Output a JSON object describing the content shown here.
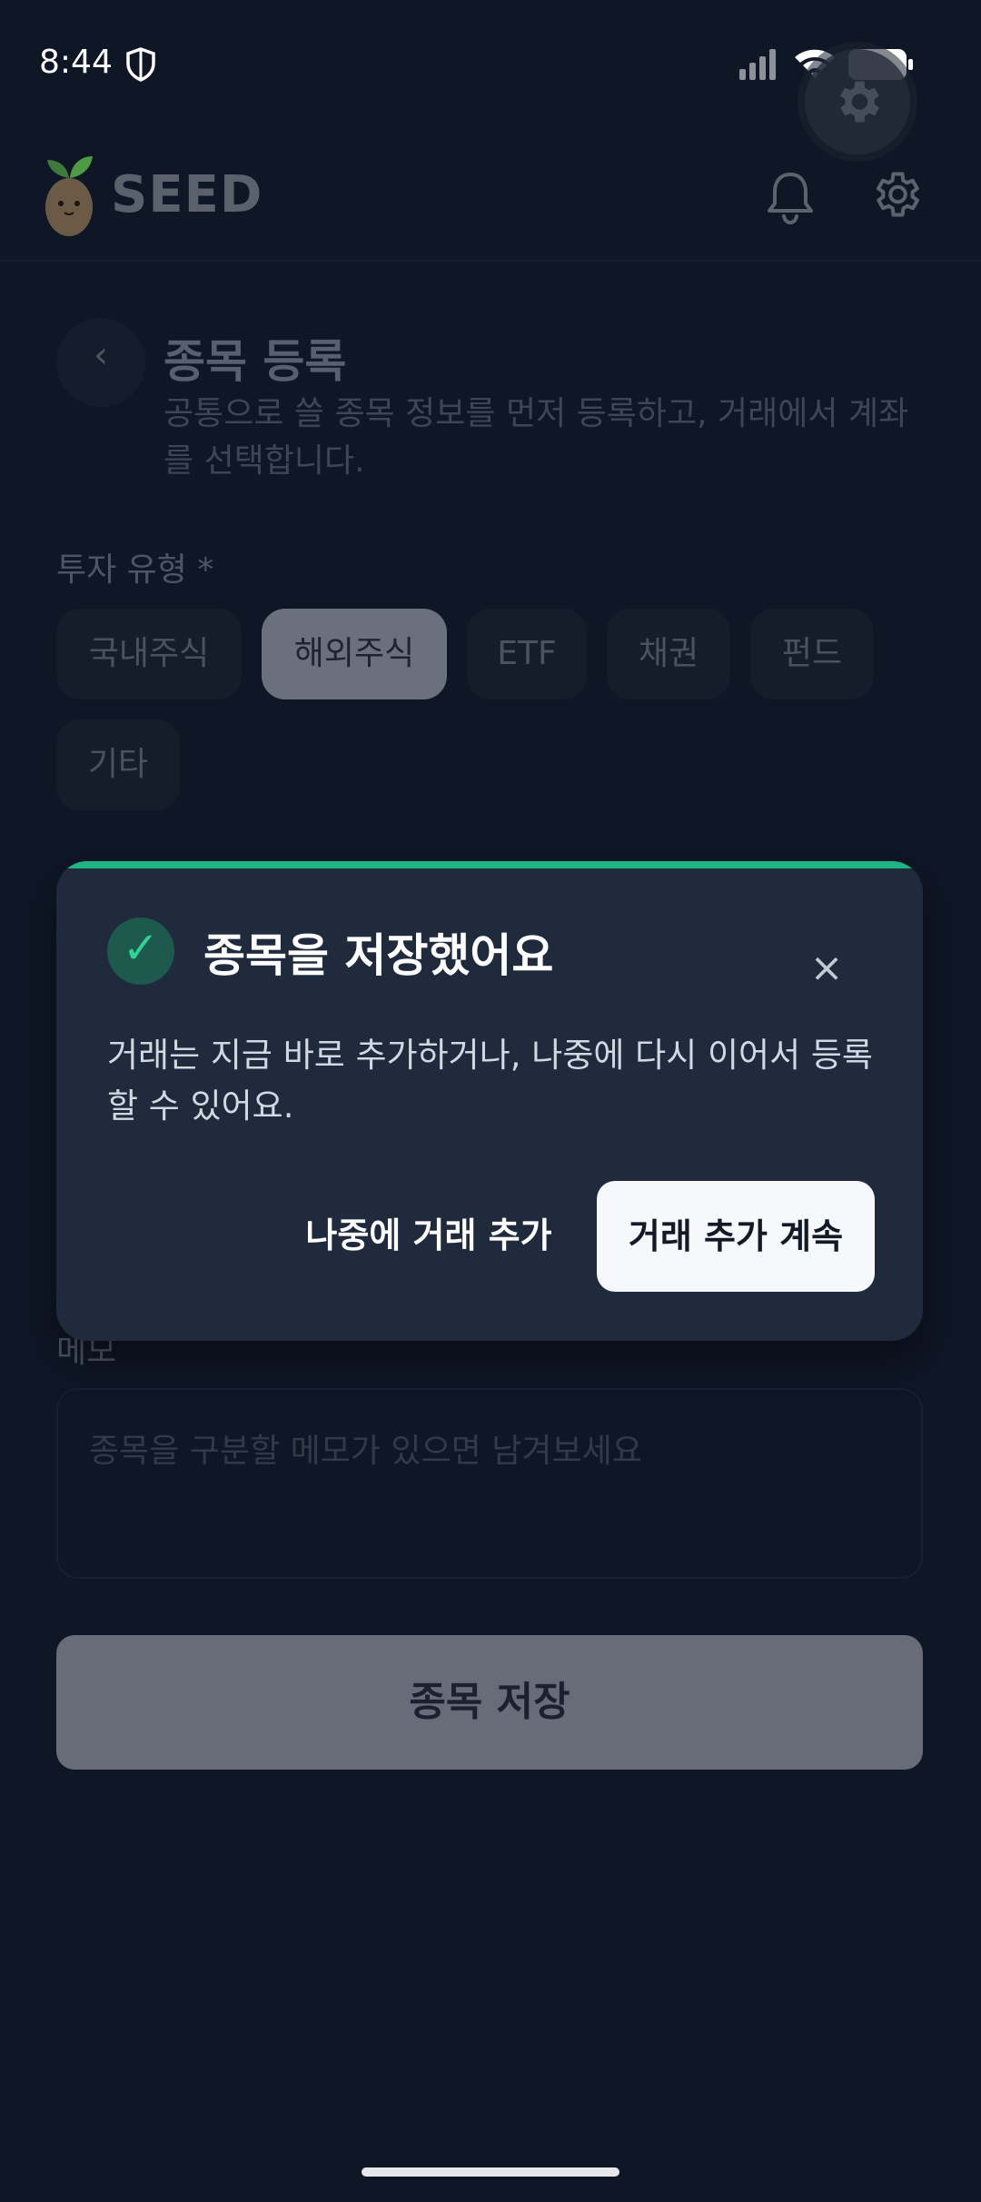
{
  "status_bar": {
    "time": "8:44"
  },
  "header": {
    "app_name": "SEED"
  },
  "page": {
    "back_glyph": "‹",
    "title": "종목 등록",
    "subtitle": "공통으로 쓸 종목 정보를 먼저 등록하고, 거래에서 계좌를 선택합니다."
  },
  "invest_type": {
    "label": "투자 유형 *",
    "options": [
      "국내주식",
      "해외주식",
      "ETF",
      "채권",
      "펀드",
      "기타"
    ],
    "selected": "해외주식"
  },
  "memo": {
    "label": "메모",
    "placeholder": "종목을 구분할 메모가 있으면 남겨보세요"
  },
  "save_button": "종목 저장",
  "toast": {
    "check_glyph": "✓",
    "title": "종목을 저장했어요",
    "close_glyph": "×",
    "message": "거래는 지금 바로 추가하거나, 나중에 다시 이어서 등록할 수 있어요.",
    "later_label": "나중에 거래 추가",
    "continue_label": "거래 추가 계속",
    "accent_color": "#20b483"
  },
  "icons": [
    "shield-icon",
    "signal-icon",
    "wifi-icon",
    "battery-icon",
    "gear-icon",
    "bell-icon",
    "seed-logo",
    "back-icon",
    "check-icon",
    "close-icon"
  ]
}
